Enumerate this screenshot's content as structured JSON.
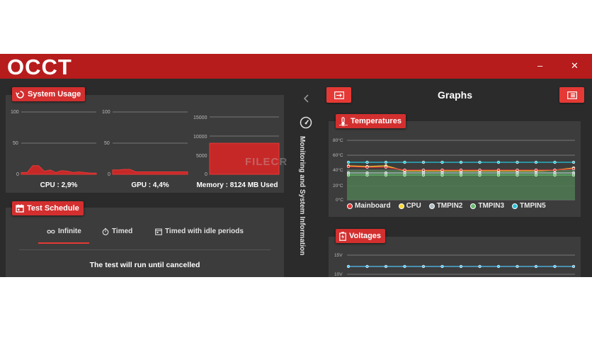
{
  "app": {
    "logo_text": "OCCT"
  },
  "window": {
    "minimize": "–",
    "close": "✕"
  },
  "system_usage": {
    "title": "System Usage",
    "cpu": {
      "label": "CPU : 2,9%",
      "y_ticks": [
        "100",
        "50",
        "0"
      ],
      "values": [
        3,
        3,
        14,
        14,
        5,
        7,
        3,
        6,
        5,
        3,
        4,
        3,
        2,
        2
      ]
    },
    "gpu": {
      "label": "GPU : 4,4%",
      "y_ticks": [
        "100",
        "50",
        "0"
      ],
      "values": [
        7,
        7,
        8,
        8,
        4,
        4,
        4,
        4,
        4,
        4,
        4,
        4,
        4,
        4
      ]
    },
    "memory": {
      "label": "Memory : 8124 MB Used",
      "y_ticks": [
        "15000",
        "10000",
        "5000",
        "0"
      ],
      "value_mb": 8124,
      "max_mb": 16000
    }
  },
  "test_schedule": {
    "title": "Test Schedule",
    "tabs": [
      "Infinite",
      "Timed",
      "Timed with idle periods"
    ],
    "active_tab": 0,
    "message": "The test will run until cancelled"
  },
  "monitoring": {
    "label": "Monitoring and System Information"
  },
  "graphs": {
    "title": "Graphs",
    "temperatures": {
      "title": "Temperatures",
      "y_ticks": [
        "80°C",
        "60°C",
        "40°C",
        "20°C",
        "0°C"
      ],
      "colors": {
        "mainboard": "#e53935",
        "cpu": "#fdd835",
        "tmpin2": "#b0bec5",
        "tmpin3": "#66bb6a",
        "tmpin5": "#26c6da"
      },
      "legend": [
        "Mainboard",
        "CPU",
        "TMPIN2",
        "TMPIN3",
        "TMPIN5"
      ]
    },
    "voltages": {
      "title": "Voltages",
      "y_ticks": [
        "15V",
        "10V"
      ]
    }
  },
  "watermark": "FILECR"
}
